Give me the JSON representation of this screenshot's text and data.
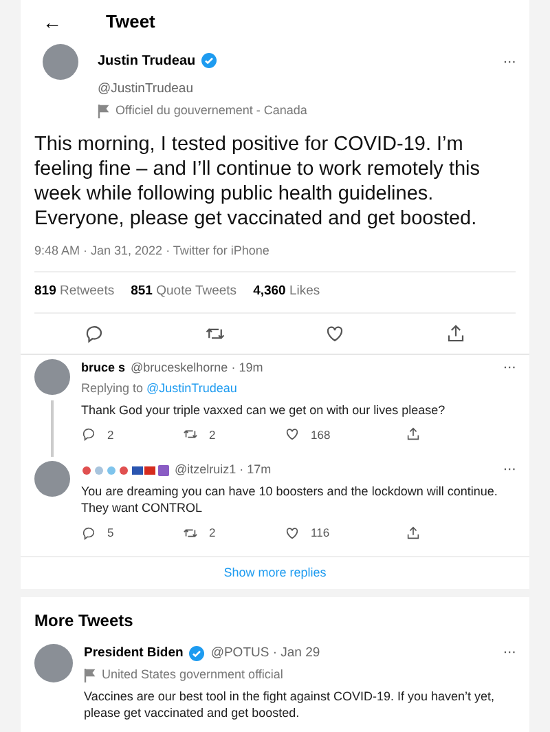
{
  "header": {
    "back": "←",
    "title": "Tweet"
  },
  "tweet": {
    "name": "Justin Trudeau",
    "verified": true,
    "handle": "@JustinTrudeau",
    "label": "Officiel du gouvernement - Canada",
    "more": "···",
    "text": "This morning, I tested positive for COVID-19. I’m feeling fine – and I’ll continue to work remotely this week while following public health guidelines. Everyone, please get vaccinated and get boosted.",
    "meta": "9:48 AM · Jan 31, 2022 · Twitter for iPhone",
    "stats": [
      {
        "count": "819",
        "label": "Retweets"
      },
      {
        "count": "851",
        "label": "Quote Tweets"
      },
      {
        "count": "4,360",
        "label": "Likes"
      }
    ]
  },
  "replies": [
    {
      "name": "bruce s",
      "handle": "@bruceskelhorne",
      "time": " · 19m",
      "replying_prefix": "Replying to ",
      "replying_to": "@JustinTrudeau",
      "text": "Thank God your triple vaxxed can we get on with our lives please?",
      "replies": "2",
      "retweets": "2",
      "likes": "168",
      "thread_line": true,
      "more": "···"
    },
    {
      "handle": "@itzelruiz1",
      "time": " · 17m",
      "text": "You are dreaming you can have 10 boosters and the lockdown will continue. They want CONTROL",
      "replies": "5",
      "retweets": "2",
      "likes": "116",
      "thread_line": false,
      "more": "···"
    }
  ],
  "show_more": "Show more replies",
  "more_tweets": {
    "title": "More Tweets",
    "items": [
      {
        "name": "President Biden",
        "verified": true,
        "handle": "@POTUS",
        "time": " · Jan 29",
        "label": "United States government official",
        "text": "Vaccines are our best tool in the fight against COVID-19. If you haven’t yet, please get vaccinated and get boosted.",
        "more": "···"
      }
    ]
  }
}
